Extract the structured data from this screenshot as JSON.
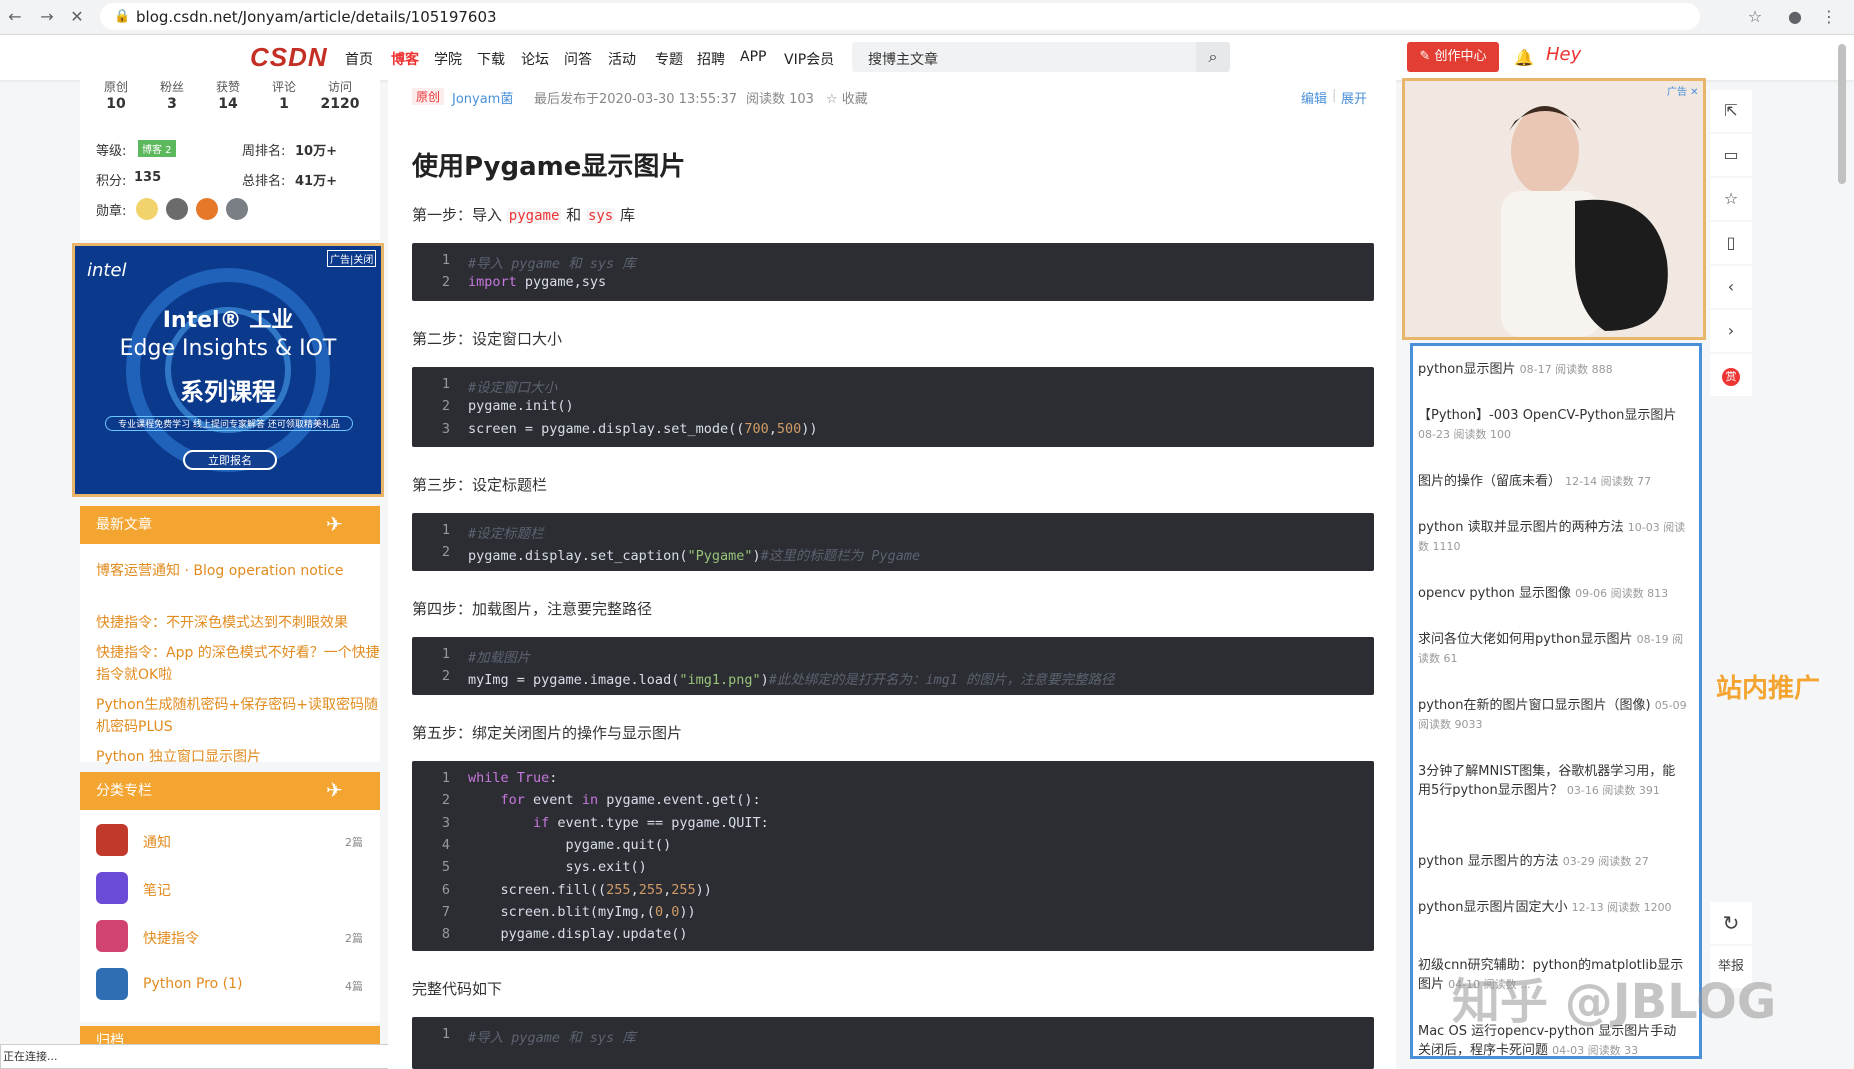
{
  "browser": {
    "url": "blog.csdn.net/Jonyam/article/details/105197603",
    "status_text": "正在连接..."
  },
  "header": {
    "logo": "CSDN",
    "menu": [
      "首页",
      "博客",
      "学院",
      "下载",
      "论坛",
      "问答",
      "活动",
      "专题",
      "招聘",
      "APP",
      "VIP会员"
    ],
    "search_placeholder": "搜博主文章",
    "create_label": "创作中心",
    "user_label": "Hey"
  },
  "profile": {
    "stat_labels": [
      "原创",
      "粉丝",
      "获赞",
      "评论",
      "访问"
    ],
    "stat_values": [
      "10",
      "3",
      "14",
      "1",
      "2120"
    ],
    "level_label": "等级:",
    "level_badge": "博客 2",
    "points_label": "积分:",
    "points_value": "135",
    "week_rank_label": "周排名:",
    "week_rank_value": "10万+",
    "total_rank_label": "总排名:",
    "total_rank_value": "41万+",
    "medal_label": "勋章:"
  },
  "ad_left": {
    "tag": "广告|关闭",
    "brand": "intel",
    "line1": "Intel® 工业",
    "line2": "Edge Insights & IOT",
    "line3": "系列课程",
    "subline": "专业课程免费学习  线上提问专家解答  还可领取精美礼品",
    "button": "立即报名"
  },
  "recent": {
    "title": "最新文章",
    "items": [
      "博客运营通知 · Blog operation notice",
      "快捷指令：不开深色模式达到不刺眼效果",
      "快捷指令：App 的深色模式不好看？一个快捷指令就OK啦",
      "Python生成随机密码+保存密码+读取密码随机密码PLUS",
      "Python 独立窗口显示图片"
    ]
  },
  "categories": {
    "title": "分类专栏",
    "items": [
      {
        "name": "通知",
        "count": "2篇"
      },
      {
        "name": "笔记",
        "count": ""
      },
      {
        "name": "快捷指令",
        "count": "2篇"
      },
      {
        "name": "Python Pro (1)",
        "count": "4篇"
      }
    ],
    "next_title": "归档"
  },
  "article": {
    "badge": "原创",
    "author": "Jonyam菌",
    "published": "最后发布于2020-03-30 13:55:37",
    "reads": "阅读数 103",
    "collect": "收藏",
    "edit": "编辑",
    "expand": "展开",
    "title": "使用Pygame显示图片",
    "step1_pre": "第一步：导入",
    "step1_code1": "pygame",
    "step1_mid": "和",
    "step1_code2": "sys",
    "step1_post": "库",
    "step2": "第二步：设定窗口大小",
    "step3": "第三步：设定标题栏",
    "step4": "第四步：加载图片，注意要完整路径",
    "step5": "第五步：绑定关闭图片的操作与显示图片",
    "full": "完整代码如下",
    "code1": [
      "#导入 pygame 和 sys 库",
      "import pygame,sys"
    ],
    "code2": [
      "#设定窗口大小",
      "pygame.init()",
      "screen = pygame.display.set_mode((700,500))"
    ],
    "code3": [
      "#设定标题栏",
      "pygame.display.set_caption(\"Pygame\")#这里的标题栏为 Pygame"
    ],
    "code4": [
      "#加载图片",
      "myImg = pygame.image.load(\"img1.png\")#此处绑定的是打开名为：img1 的图片，注意要完整路径"
    ],
    "code5": [
      "while True:",
      "    for event in pygame.event.get():",
      "        if event.type == pygame.QUIT:",
      "            pygame.quit()",
      "            sys.exit()",
      "    screen.fill((255,255,255))",
      "    screen.blit(myImg,(0,0))",
      "    pygame.display.update()"
    ],
    "code6": [
      "#导入 pygame 和 sys 库"
    ]
  },
  "ad_right": {
    "tag": "广告"
  },
  "recommend": {
    "items": [
      {
        "title": "python显示图片",
        "meta": "08-17   阅读数 888"
      },
      {
        "title": "【Python】-003 OpenCV-Python显示图片",
        "meta": "08-23   阅读数 100"
      },
      {
        "title": "图片的操作（留底未看）",
        "meta": "12-14   阅读数 77"
      },
      {
        "title": "python 读取并显示图片的两种方法",
        "meta": "10-03   阅读数 1110"
      },
      {
        "title": "opencv python 显示图像",
        "meta": "09-06   阅读数 813"
      },
      {
        "title": "求问各位大佬如何用python显示图片",
        "meta": "08-19   阅读数 61"
      },
      {
        "title": "python在新的图片窗口显示图片（图像)",
        "meta": "05-09   阅读数 9033"
      },
      {
        "title": "3分钟了解MNIST图集，谷歌机器学习用，能用5行python显示图片？",
        "meta": "03-16   阅读数 391"
      },
      {
        "title": "python 显示图片的方法",
        "meta": "03-29   阅读数 27"
      },
      {
        "title": "python显示图片固定大小",
        "meta": "12-13   阅读数 1200"
      },
      {
        "title": "初级cnn研究辅助：python的matplotlib显示图片",
        "meta": "04-10   阅读数 ..."
      },
      {
        "title": "Mac OS 运行opencv-python 显示图片手动关闭后，程序卡死问题",
        "meta": "04-03   阅读数 33"
      }
    ],
    "side_label": "站内推广"
  },
  "toolbar": {
    "report": "举报"
  },
  "watermark": "知乎 @JBLOG",
  "colors": {
    "brand": "#c32f24",
    "accent": "#f4a531",
    "code_bg": "#2b2d33",
    "rec_border": "#4a90d9"
  }
}
